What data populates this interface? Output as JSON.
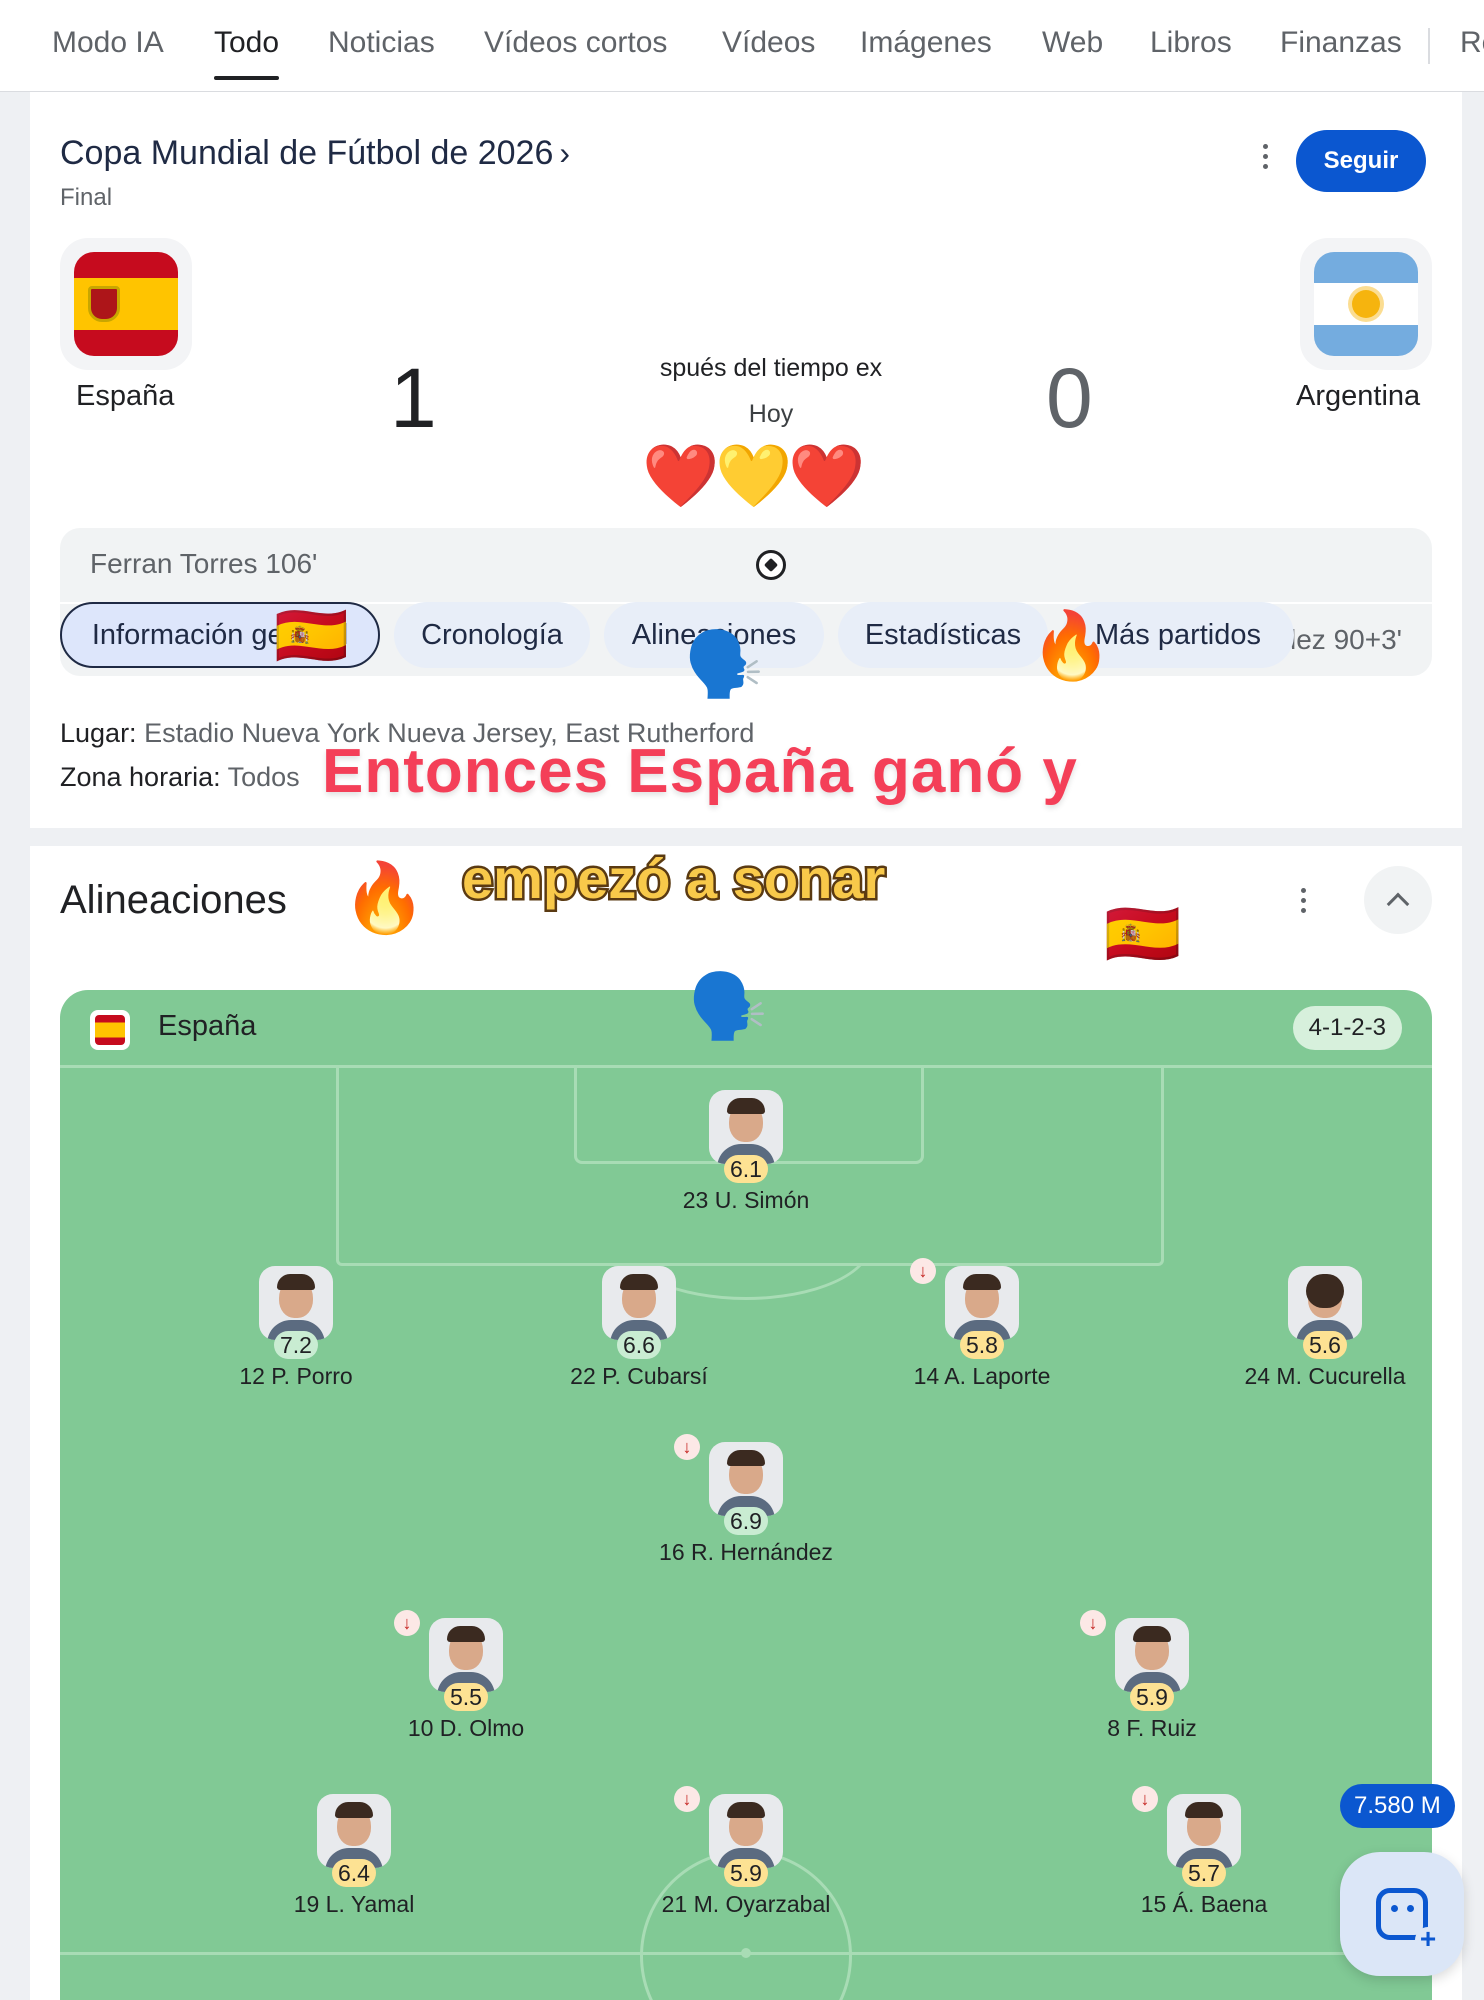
{
  "tabs": [
    {
      "label": "Modo IA"
    },
    {
      "label": "Todo"
    },
    {
      "label": "Noticias"
    },
    {
      "label": "Vídeos cortos"
    },
    {
      "label": "Vídeos"
    },
    {
      "label": "Imágenes"
    },
    {
      "label": "Web"
    },
    {
      "label": "Libros"
    },
    {
      "label": "Finanzas"
    },
    {
      "label": "Re"
    }
  ],
  "active_tab": "Todo",
  "match": {
    "title": "Copa Mundial de Fútbol de 2026",
    "title_chevron": "›",
    "stage": "Final",
    "follow_label": "Seguir",
    "home": {
      "name": "España",
      "score": "1"
    },
    "away": {
      "name": "Argentina",
      "score": "0"
    },
    "status": "spués del tiempo ex",
    "date": "Hoy",
    "reaction_emojis": "❤️💛❤️",
    "events": [
      {
        "side": "home",
        "text": "Ferran Torres 106'",
        "type": "goal"
      },
      {
        "side": "away",
        "text": "Enzo Fernández 90+3'",
        "type": "red-card"
      }
    ]
  },
  "chips": [
    {
      "label": "Información general"
    },
    {
      "label": "Cronología"
    },
    {
      "label": "Alineaciones"
    },
    {
      "label": "Estadísticas"
    },
    {
      "label": "Más partidos"
    }
  ],
  "venue": {
    "place_label": "Lugar:",
    "place_value": "Estadio Nueva York Nueva Jersey, East Rutherford",
    "timezone_label": "Zona horaria:",
    "timezone_value": "Todos"
  },
  "captions": {
    "line1": "Entonces España ganó y",
    "line2": "empezó a sonar"
  },
  "overlay_emojis": {
    "flag": "🇪🇸",
    "fire": "🔥",
    "speaking": "🗣️"
  },
  "lineups": {
    "title": "Alineaciones",
    "team": "España",
    "formation": "4-1-2-3",
    "players": [
      {
        "name": "23 U. Simón",
        "rating": "6.1",
        "subbed": false
      },
      {
        "name": "12 P. Porro",
        "rating": "7.2",
        "subbed": false
      },
      {
        "name": "22 P. Cubarsí",
        "rating": "6.6",
        "subbed": false
      },
      {
        "name": "14 A. Laporte",
        "rating": "5.8",
        "subbed": true
      },
      {
        "name": "24 M. Cucurella",
        "rating": "5.6",
        "subbed": false
      },
      {
        "name": "16 R. Hernández",
        "rating": "6.9",
        "subbed": true
      },
      {
        "name": "10 D. Olmo",
        "rating": "5.5",
        "subbed": true
      },
      {
        "name": "8 F. Ruiz",
        "rating": "5.9",
        "subbed": true
      },
      {
        "name": "19 L. Yamal",
        "rating": "6.4",
        "subbed": false
      },
      {
        "name": "21 M. Oyarzabal",
        "rating": "5.9",
        "subbed": true
      },
      {
        "name": "15 Á. Baena",
        "rating": "5.7",
        "subbed": true
      }
    ]
  },
  "views_badge": "7.580 M",
  "icons": {
    "goal": "soccer-ball-icon",
    "red_card": "red-card-icon",
    "more": "more-vert-icon",
    "collapse": "chevron-up-icon",
    "substitution": "arrow-down-icon",
    "fab": "ai-face-plus-icon"
  },
  "colors": {
    "accent": "#0b57d0",
    "pitch": "#81c995",
    "rating_high": "#c9ecd2",
    "rating_mid": "#fde293",
    "caption1": "#f43f58",
    "caption2": "#f8c94a"
  }
}
